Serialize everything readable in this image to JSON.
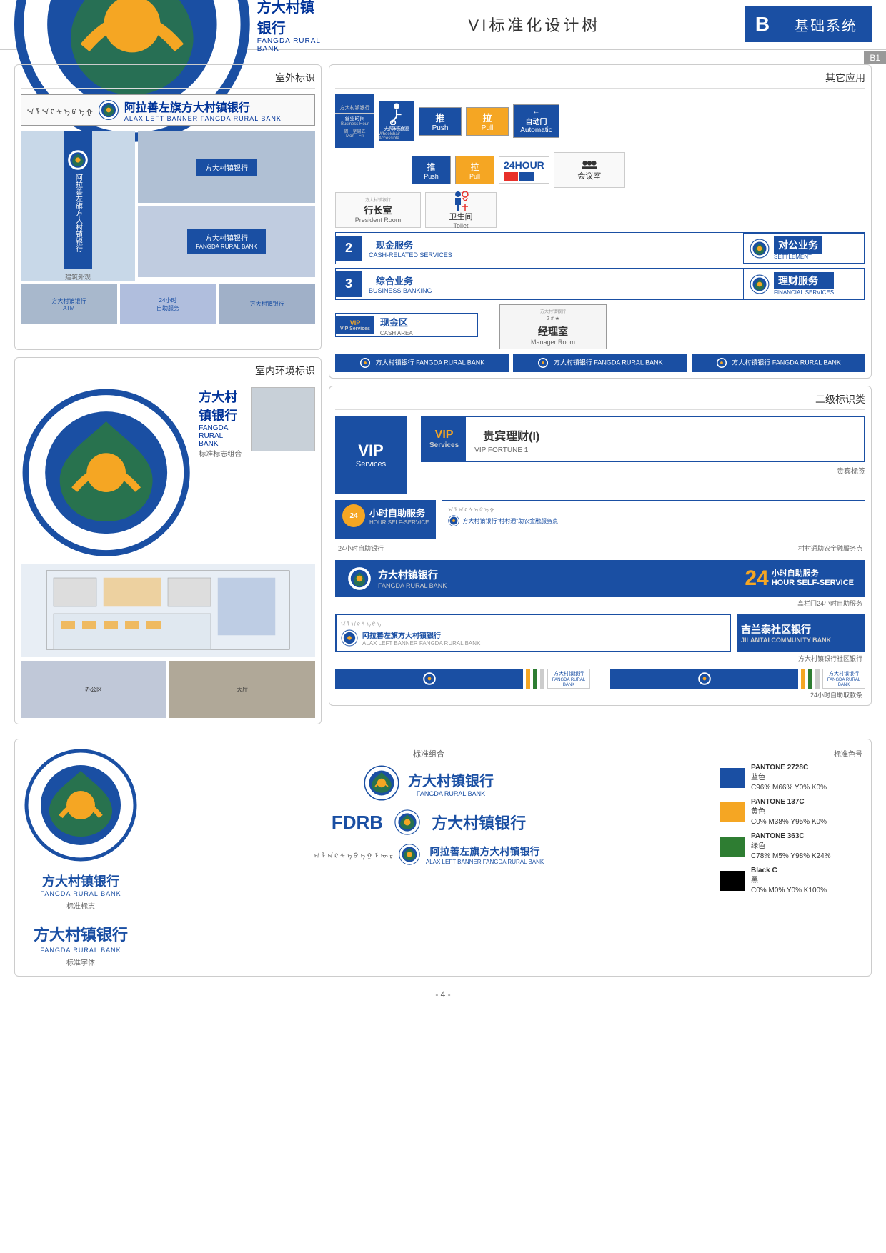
{
  "header": {
    "logo_cn": "方大村镇银行",
    "logo_en": "FANGDA RURAL BANK",
    "center_title": "VI标准化设计树",
    "b_badge": "B",
    "system_label": "基础系统",
    "b1_label": "B1"
  },
  "outdoor_section": {
    "title": "室外标识",
    "banner_mongolian": "ᠠ ᠯ ᠠ ᠺ",
    "banner_cn": "阿拉善左旗方大村镇银行",
    "banner_en": "ALAX LEFT BANNER FANGDA RURAL BANK",
    "building_photos": [
      "building photo 1",
      "building photo 2",
      "building photo 3",
      "building photo 4"
    ],
    "atm_photos": [
      "ATM photo 1",
      "ATM photo 2",
      "ATM photo 3"
    ]
  },
  "indoor_section": {
    "title": "室内环境标识",
    "bank_cn": "方大村镇银行",
    "bank_en": "FANGDA RURAL BANK",
    "subtitle": "标准标志组合",
    "floor_plan": "floor plan",
    "interior_photos": [
      "interior photo 1",
      "interior photo 2"
    ]
  },
  "other_apps": {
    "title": "其它应用",
    "push": "推",
    "push_en": "Push",
    "pull": "拉",
    "pull_en": "Pull",
    "auto_door": "自动门",
    "auto_door_en": "Automatic",
    "wheelchair": "无障碍通道",
    "wheelchair_en": "Wheelchair Accessible",
    "hours_24": "24HOUR",
    "president_room_cn": "行长室",
    "president_room_en": "President Room",
    "toilet_cn": "卫生间",
    "toilet_en": "Toilet",
    "conference_cn": "会议室",
    "cash_services_cn": "现金服务",
    "cash_services_en": "CASH-RELATED SERVICES",
    "settlement_cn": "对公业务",
    "settlement_en": "SETTLEMENT",
    "business_banking_cn": "综合业务",
    "business_banking_en": "BUSINESS BANKING",
    "financial_services_cn": "理财服务",
    "financial_services_en": "FINANCIAL SERVICES",
    "cash_area_cn": "现金区",
    "cash_area_en": "CASH AREA",
    "vip_services": "VIP Services",
    "manager_room_cn": "经理室",
    "manager_room_en": "Manager Room",
    "num2": "2",
    "num3": "3",
    "branch_names": [
      "方大村镇银行 FANGDA RURAL BANK",
      "方大村镇银行 FANGDA RURAL BANK",
      "方大村镇银行 FANGDA RURAL BANK"
    ]
  },
  "secondary_signs": {
    "title": "二级标识类",
    "vip_services_label": "VIP",
    "vip_services_sub": "Services",
    "vip_fortune_vip": "VIP",
    "vip_fortune_services": "Services",
    "vip_fortune_cn": "贵宾理财(I)",
    "vip_fortune_en": "VIP FORTUNE 1",
    "fortune_tag": "贵宾标签",
    "atm_24h_cn": "小时自助服务",
    "atm_24h_num": "24",
    "atm_24h_en": "HOUR SELF-SERVICE",
    "atm_small_note": "24小时自助银行",
    "village_note": "村村通助农金融服务点",
    "bank_cn_big": "方大村镇银行",
    "bank_en_big": "FANGDA RURAL BANK",
    "hours_24_big": "24",
    "self_service_big": "小时自助服务",
    "self_service_en_big": "HOUR SELF-SERVICE",
    "community_bank_note": "方大村镇银行社区银行",
    "community_right_cn": "吉兰泰社区银行",
    "community_right_en": "JILANTAI COMMUNITY BANK",
    "sticker_note": "24小时自助取款条"
  },
  "bottom_section": {
    "std_logo_label": "标准标志",
    "std_font_label": "标准字体",
    "std_combo_label": "标准组合",
    "std_color_label": "标准色号",
    "bank_cn": "方大村镇银行",
    "bank_en": "FANGDA RURAL BANK",
    "fdrb": "FDRB",
    "fdrb_cn": "方大村镇银行",
    "mongolian_banner_cn": "阿拉善左旗方大村镇银行",
    "mongolian_banner_en": "ALAX LEFT BANNER FANGDA RURAL BANK",
    "colors": [
      {
        "name": "PANTONE 2728C",
        "name_cn": "蓝色",
        "formula": "C96% M66% Y0% K0%",
        "hex": "#1a4fa3"
      },
      {
        "name": "PANTONE 137C",
        "name_cn": "黄色",
        "formula": "C0% M38% Y95% K0%",
        "hex": "#f5a623"
      },
      {
        "name": "PANTONE 363C",
        "name_cn": "绿色",
        "formula": "C78% M5% Y98% K24%",
        "hex": "#2e7d32"
      },
      {
        "name": "Black C",
        "name_cn": "黑",
        "formula": "C0% M0% Y0% K100%",
        "hex": "#000000"
      }
    ]
  },
  "page_number": "- 4 -"
}
